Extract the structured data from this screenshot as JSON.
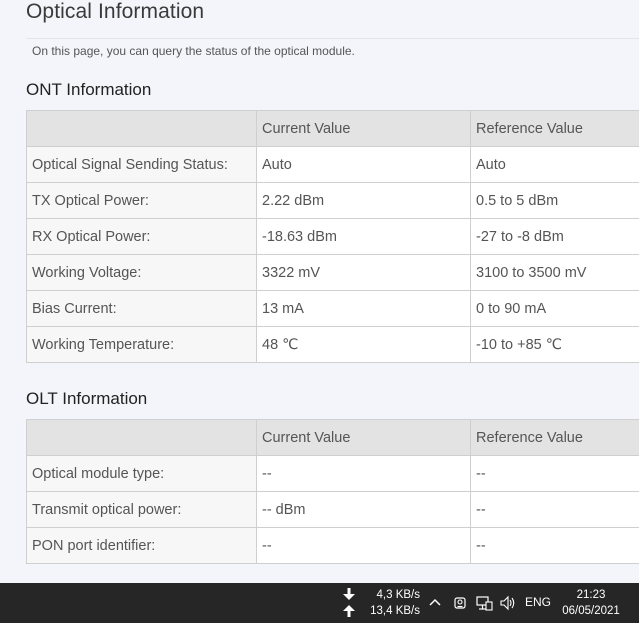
{
  "page": {
    "title": "Optical Information",
    "description": "On this page, you can query the status of the optical module."
  },
  "ont": {
    "section_title": "ONT Information",
    "headers": [
      "",
      "Current Value",
      "Reference Value"
    ],
    "rows": [
      {
        "label": "Optical Signal Sending Status:",
        "current": "Auto",
        "reference": "Auto"
      },
      {
        "label": "TX Optical Power:",
        "current": "2.22 dBm",
        "reference": "0.5 to 5 dBm"
      },
      {
        "label": "RX Optical Power:",
        "current": "-18.63 dBm",
        "reference": "-27 to -8 dBm"
      },
      {
        "label": "Working Voltage:",
        "current": "3322 mV",
        "reference": "3100 to 3500 mV"
      },
      {
        "label": "Bias Current:",
        "current": "13 mA",
        "reference": "0 to 90 mA"
      },
      {
        "label": "Working Temperature:",
        "current": "48 ℃",
        "reference": "-10 to +85 ℃"
      }
    ]
  },
  "olt": {
    "section_title": "OLT Information",
    "headers": [
      "",
      "Current Value",
      "Reference Value"
    ],
    "rows": [
      {
        "label": "Optical module type:",
        "current": "--",
        "reference": "--"
      },
      {
        "label": "Transmit optical power:",
        "current": "-- dBm",
        "reference": "--"
      },
      {
        "label": "PON port identifier:",
        "current": "--",
        "reference": "--"
      }
    ]
  },
  "taskbar": {
    "download_speed": "4,3 KB/s",
    "upload_speed": "13,4 KB/s",
    "language": "ENG",
    "time": "21:23",
    "date": "06/05/2021",
    "icons": [
      "download-arrow-icon",
      "upload-arrow-icon",
      "chevron-up-icon",
      "meet-now-icon",
      "network-icon",
      "volume-icon"
    ],
    "colors": {
      "background": "#262626",
      "text": "#ffffff"
    }
  }
}
